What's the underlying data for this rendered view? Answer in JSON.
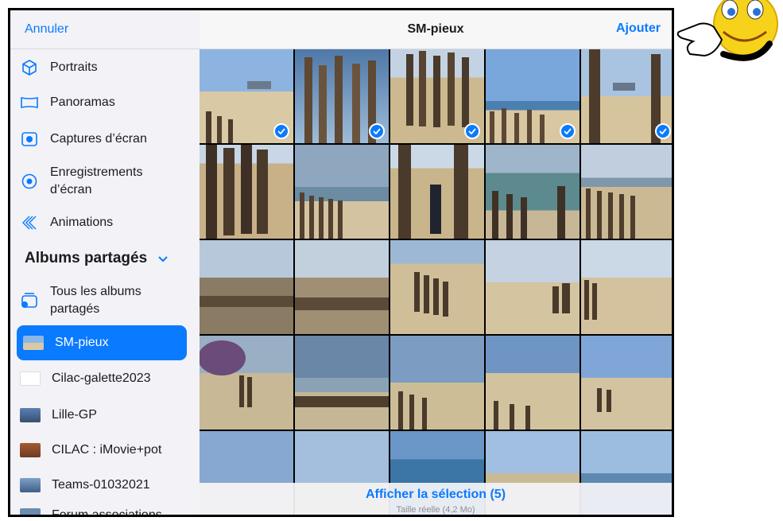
{
  "sidebar": {
    "cancel_label": "Annuler",
    "items": [
      {
        "label": "Portraits",
        "icon": "cube-icon"
      },
      {
        "label": "Panoramas",
        "icon": "panorama-icon"
      },
      {
        "label": "Captures d’écran",
        "icon": "camera-icon"
      },
      {
        "label": "Enregistrements d’écran",
        "icon": "record-icon"
      },
      {
        "label": "Animations",
        "icon": "animation-icon"
      }
    ],
    "section_title": "Albums partagés",
    "shared": [
      {
        "label": "Tous les albums partagés",
        "icon": "shared-albums-icon"
      },
      {
        "label": "SM-pieux",
        "selected": true
      },
      {
        "label": "Cilac-galette2023"
      },
      {
        "label": "Lille-GP"
      },
      {
        "label": "CILAC : iMovie+pot"
      },
      {
        "label": "Teams-01032021"
      },
      {
        "label": "Forum associations"
      }
    ]
  },
  "header": {
    "title": "SM-pieux",
    "add_label": "Ajouter"
  },
  "footer": {
    "selection_label": "Afficher la sélection (5)",
    "size_label": "Taille réelle (4,2 Mo)"
  },
  "selection": {
    "selected_count": 5
  },
  "colors": {
    "accent": "#0a7aff",
    "sidebar_bg": "#f2f2f7",
    "selected_text": "#ffffff"
  }
}
